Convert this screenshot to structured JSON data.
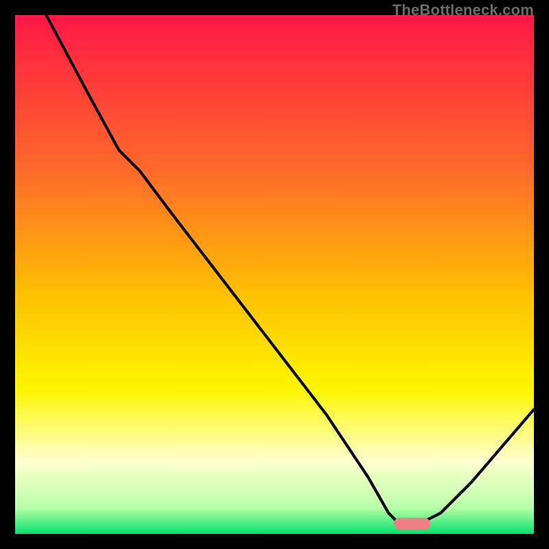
{
  "watermark": "TheBottleneck.com",
  "chart_data": {
    "type": "line",
    "title": "",
    "xlabel": "",
    "ylabel": "",
    "xlim": [
      0,
      100
    ],
    "ylim": [
      0,
      100
    ],
    "grid": false,
    "legend": false,
    "background": "vertical-gradient red→orange→yellow→pale-yellow→green",
    "gradient_stops": [
      {
        "offset": 0,
        "color": "#ff1846"
      },
      {
        "offset": 30,
        "color": "#ff6a2a"
      },
      {
        "offset": 55,
        "color": "#ffc400"
      },
      {
        "offset": 72,
        "color": "#fff600"
      },
      {
        "offset": 86,
        "color": "#ffffcf"
      },
      {
        "offset": 95,
        "color": "#b8ffa8"
      },
      {
        "offset": 100,
        "color": "#00e36b"
      }
    ],
    "curve_note": "y is mismatch level; 0 at bottom (green) = optimal, 100 at top (red) = worst",
    "series": [
      {
        "name": "bottleneck-curve",
        "color": "#000000",
        "width": 3,
        "x": [
          6,
          14,
          20,
          24,
          30,
          40,
          50,
          60,
          68,
          72,
          74,
          78,
          82,
          88,
          100
        ],
        "y": [
          100,
          85,
          74,
          70,
          62,
          49,
          36,
          23,
          11,
          4,
          2,
          2,
          4,
          10,
          24
        ]
      }
    ],
    "marker": {
      "name": "optimal-range-marker",
      "color": "#ef7f86",
      "shape": "rounded-bar",
      "x_start": 73,
      "x_end": 80,
      "y": 2,
      "height": 2.2
    }
  }
}
